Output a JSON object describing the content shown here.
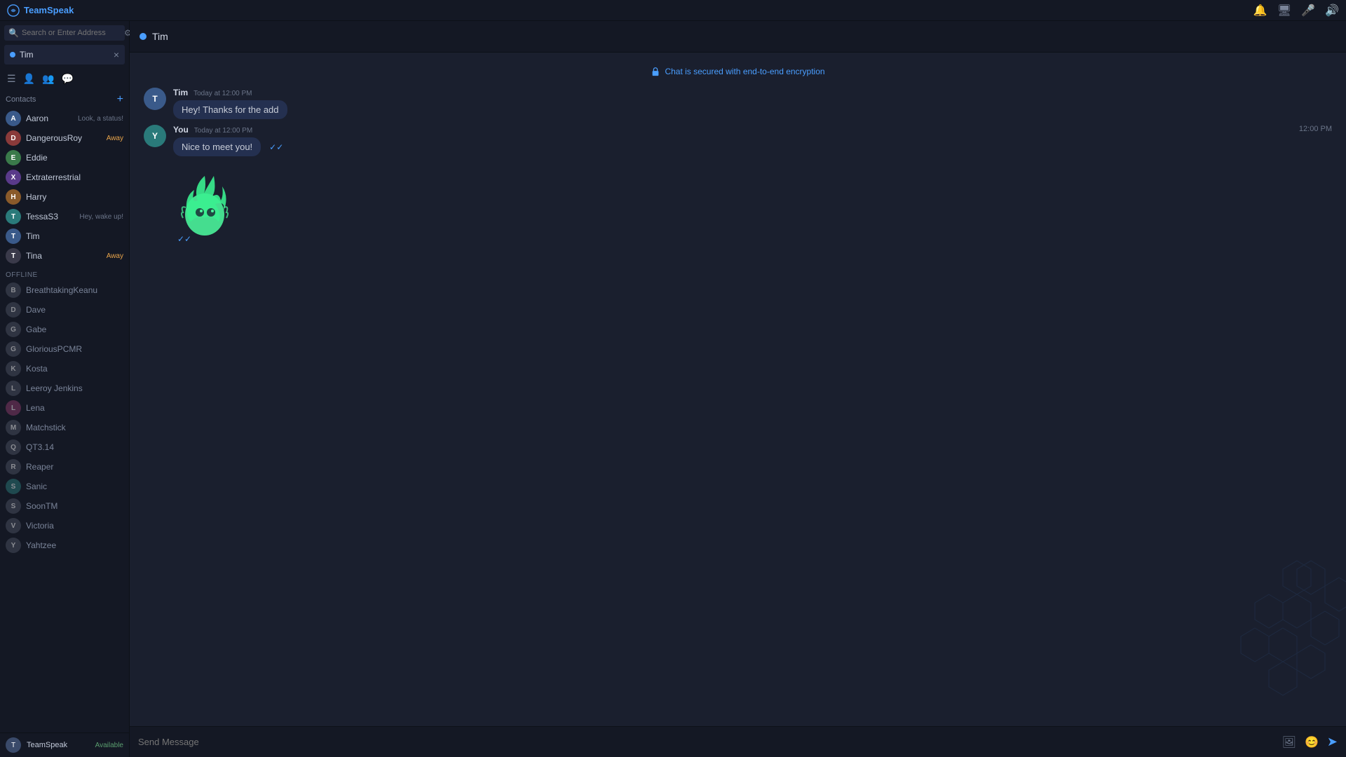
{
  "app": {
    "name": "TeamSpeak",
    "title": "TeamSpeak"
  },
  "topbar": {
    "logo_label": "teamspeak",
    "notification_icon": "🔔",
    "server_icon": "🖥",
    "mic_icon": "🎤",
    "speaker_icon": "🔊"
  },
  "sidebar": {
    "search_placeholder": "Search or Enter Address",
    "active_chat": {
      "name": "Tim",
      "close_label": "×"
    },
    "contacts_label": "Contacts",
    "add_contact_icon": "+",
    "online_contacts": [
      {
        "name": "Aaron",
        "status": "Look, a status!",
        "avatar_color": "av-blue",
        "initial": "A"
      },
      {
        "name": "DangerousRoy",
        "status": "Away",
        "status_type": "away",
        "avatar_color": "av-red",
        "initial": "D"
      },
      {
        "name": "Eddie",
        "status": "",
        "avatar_color": "av-green",
        "initial": "E"
      },
      {
        "name": "Extraterrestrial",
        "status": "",
        "avatar_color": "av-purple",
        "initial": "X"
      },
      {
        "name": "Harry",
        "status": "",
        "avatar_color": "av-orange",
        "initial": "H"
      },
      {
        "name": "TessaS3",
        "status": "Hey, wake up!",
        "avatar_color": "av-teal",
        "initial": "T"
      },
      {
        "name": "Tim",
        "status": "",
        "avatar_color": "av-blue",
        "initial": "T"
      },
      {
        "name": "Tina",
        "status": "Away",
        "status_type": "away",
        "avatar_color": "av-dark",
        "initial": "T"
      }
    ],
    "offline_section_label": "Offline",
    "offline_contacts": [
      {
        "name": "BreathtakingKeanu",
        "avatar_color": "av-gray",
        "initial": "B"
      },
      {
        "name": "Dave",
        "avatar_color": "av-gray",
        "initial": "D"
      },
      {
        "name": "Gabe",
        "avatar_color": "av-gray",
        "initial": "G"
      },
      {
        "name": "GloriousPCMR",
        "avatar_color": "av-gray",
        "initial": "G"
      },
      {
        "name": "Kosta",
        "avatar_color": "av-gray",
        "initial": "K"
      },
      {
        "name": "Leeroy Jenkins",
        "avatar_color": "av-gray",
        "initial": "L"
      },
      {
        "name": "Lena",
        "avatar_color": "av-pink",
        "initial": "L"
      },
      {
        "name": "Matchstick",
        "avatar_color": "av-gray",
        "initial": "M"
      },
      {
        "name": "QT3.14",
        "avatar_color": "av-gray",
        "initial": "Q"
      },
      {
        "name": "Reaper",
        "avatar_color": "av-gray",
        "initial": "R"
      },
      {
        "name": "Sanic",
        "avatar_color": "av-teal",
        "initial": "S"
      },
      {
        "name": "SoonTM",
        "avatar_color": "av-gray",
        "initial": "S"
      },
      {
        "name": "Victoria",
        "avatar_color": "av-gray",
        "initial": "V"
      },
      {
        "name": "Yahtzee",
        "avatar_color": "av-gray",
        "initial": "Y"
      }
    ],
    "bottom_user": {
      "name": "TeamSpeak",
      "status": "Available",
      "initial": "T"
    }
  },
  "chat": {
    "header_name": "Tim",
    "encryption_notice": "Chat is secured with end-to-end encryption",
    "messages": [
      {
        "sender": "Tim",
        "time": "Today at 12:00 PM",
        "text": "Hey! Thanks for the add",
        "timestamp_right": "",
        "is_self": false,
        "has_check": false
      },
      {
        "sender": "You",
        "time": "Today at 12:00 PM",
        "text": "Nice to meet you!",
        "timestamp_right": "12:00 PM",
        "is_self": true,
        "has_check": true
      }
    ],
    "sticker_check": "✓✓",
    "input_placeholder": "Send Message"
  }
}
